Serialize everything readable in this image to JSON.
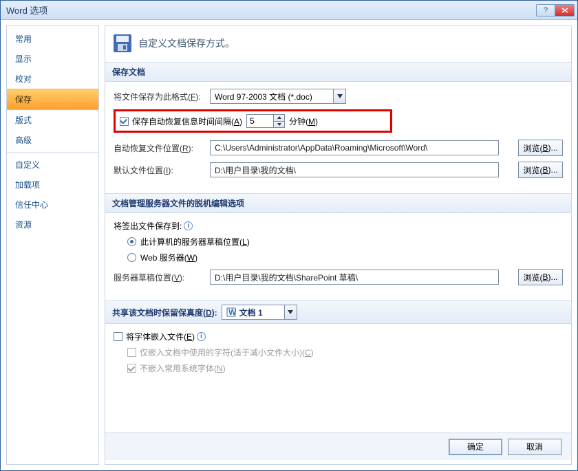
{
  "window": {
    "title": "Word 选项"
  },
  "sidebar": {
    "items": [
      "常用",
      "显示",
      "校对",
      "保存",
      "版式",
      "高级"
    ],
    "items2": [
      "自定义",
      "加载项",
      "信任中心",
      "资源"
    ],
    "selected_index": 3
  },
  "header": {
    "text": "自定义文档保存方式。"
  },
  "groups": {
    "save_docs": {
      "title": "保存文档",
      "format_label": "将文件保存为此格式(F):",
      "format_value": "Word 97-2003 文档 (*.doc)",
      "autorecover_label": "保存自动恢复信息时间间隔(A)",
      "autorecover_value": "5",
      "autorecover_unit": "分钟(M)",
      "autorecover_loc_label": "自动恢复文件位置(R):",
      "autorecover_loc_value": "C:\\Users\\Administrator\\AppData\\Roaming\\Microsoft\\Word\\",
      "default_loc_label": "默认文件位置(I):",
      "default_loc_value": "D:\\用户目录\\我的文档\\",
      "browse": "浏览(B)..."
    },
    "offline": {
      "title": "文档管理服务器文件的脱机编辑选项",
      "save_to_label": "将签出文件保存到:",
      "radio_local": "此计算机的服务器草稿位置(L)",
      "radio_web": "Web 服务器(W)",
      "server_loc_label": "服务器草稿位置(V):",
      "server_loc_value": "D:\\用户目录\\我的文档\\SharePoint 草稿\\",
      "browse": "浏览(B)..."
    },
    "fidelity": {
      "title": "共享该文档时保留保真度(D):",
      "doc_name": "文档 1",
      "embed_fonts": "将字体嵌入文件(E)",
      "embed_used_only": "仅嵌入文档中使用的字符(适于减小文件大小)(C)",
      "no_sys_fonts": "不嵌入常用系统字体(N)"
    }
  },
  "footer": {
    "ok": "确定",
    "cancel": "取消"
  },
  "icons": {
    "info": "i"
  }
}
